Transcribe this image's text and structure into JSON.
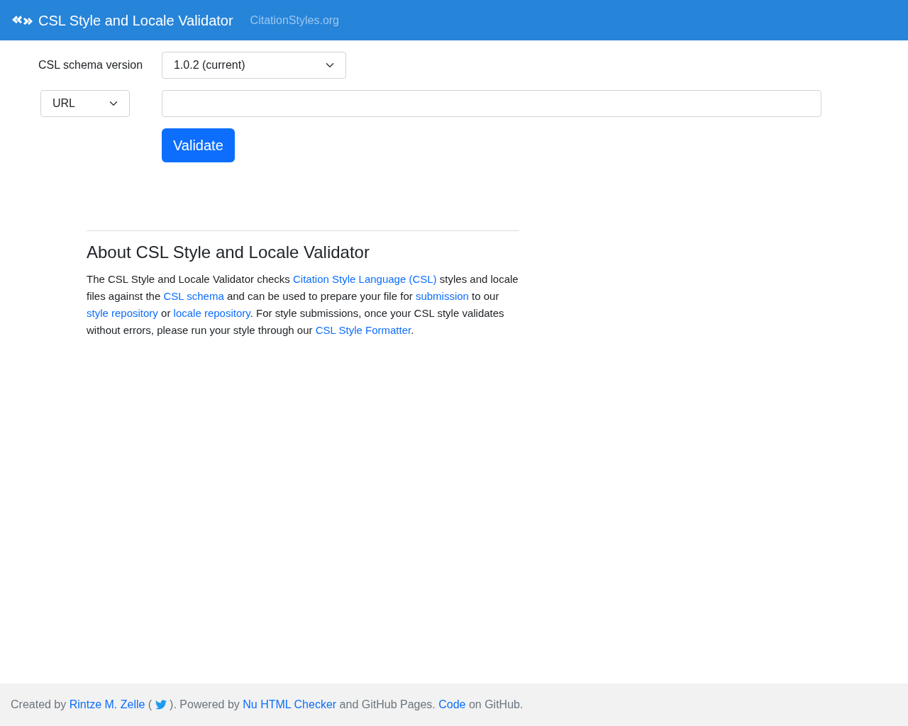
{
  "navbar": {
    "brand": "CSL Style and Locale Validator",
    "link": "CitationStyles.org"
  },
  "form": {
    "schema_label": "CSL schema version",
    "schema_value": "1.0.2 (current)",
    "source_value": "URL",
    "button": "Validate"
  },
  "about": {
    "title": "About CSL Style and Locale Validator",
    "paragraph": [
      {
        "kind": "text",
        "text": "The CSL Style and Locale Validator checks "
      },
      {
        "kind": "link",
        "text": "Citation Style Language (CSL)"
      },
      {
        "kind": "text",
        "text": " styles and locale files against the "
      },
      {
        "kind": "link",
        "text": "CSL schema"
      },
      {
        "kind": "text",
        "text": " and can be used to prepare your file for "
      },
      {
        "kind": "link",
        "text": "submission"
      },
      {
        "kind": "text",
        "text": " to our "
      },
      {
        "kind": "link",
        "text": "style repository"
      },
      {
        "kind": "text",
        "text": " or "
      },
      {
        "kind": "link",
        "text": "locale repository"
      },
      {
        "kind": "text",
        "text": ". For style submissions, once your CSL style validates without errors, please run your style through our "
      },
      {
        "kind": "link",
        "text": "CSL Style Formatter"
      },
      {
        "kind": "text",
        "text": "."
      }
    ]
  },
  "footer": [
    {
      "kind": "text",
      "text": "Created by "
    },
    {
      "kind": "link",
      "text": "Rintze M. Zelle"
    },
    {
      "kind": "text",
      "text": " ( "
    },
    {
      "kind": "icon"
    },
    {
      "kind": "text",
      "text": " ). Powered by "
    },
    {
      "kind": "link",
      "text": "Nu HTML Checker"
    },
    {
      "kind": "text",
      "text": " and GitHub Pages. "
    },
    {
      "kind": "link",
      "text": "Code"
    },
    {
      "kind": "text",
      "text": " on GitHub."
    }
  ]
}
